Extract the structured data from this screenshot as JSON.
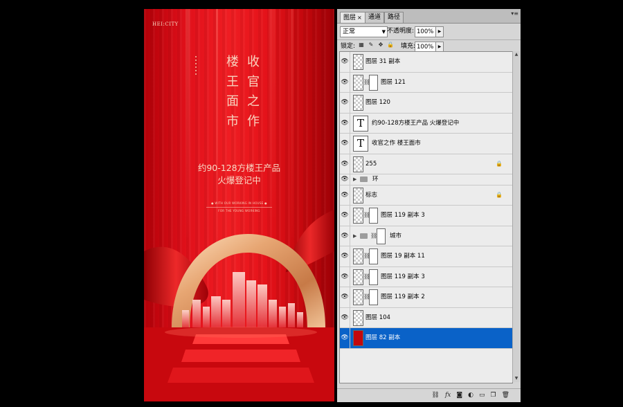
{
  "poster": {
    "brand": "HEI:CITY",
    "vertical_text_left": [
      "楼",
      "王",
      "面",
      "市"
    ],
    "vertical_text_right": [
      "收",
      "官",
      "之",
      "作"
    ],
    "subtitle_line1": "约90-128方楼王产品",
    "subtitle_line2": "火爆登记中",
    "small_text_line1": "● WITH OUR WORKING IN HOUSE  ●",
    "small_text_line2": "FOR THE YOUNG WORKING"
  },
  "panel": {
    "tabs": [
      {
        "label": "图层",
        "active": true
      },
      {
        "label": "通道",
        "active": false
      },
      {
        "label": "路径",
        "active": false
      }
    ],
    "tab_close": "×",
    "blend_mode": "正常",
    "opacity_label": "不透明度:",
    "opacity_value": "100%",
    "lock_label": "锁定:",
    "fill_label": "填充:",
    "fill_value": "100%",
    "layers": [
      {
        "name": "图层 31 副本",
        "type": "pixel"
      },
      {
        "name": "图层 121",
        "type": "masked"
      },
      {
        "name": "图层 120",
        "type": "pixel"
      },
      {
        "name": "约90-128方楼王产品 火爆登记中",
        "type": "text"
      },
      {
        "name": "收官之作 楼王面市",
        "type": "text"
      },
      {
        "name": "255",
        "type": "pixel",
        "locked": true
      },
      {
        "name": "环",
        "type": "group"
      },
      {
        "name": "标志",
        "type": "pixel",
        "locked": true
      },
      {
        "name": "图层 119 副本 3",
        "type": "masked"
      },
      {
        "name": "城市",
        "type": "group-masked"
      },
      {
        "name": "图层 19 副本 11",
        "type": "masked"
      },
      {
        "name": "图层 119 副本 3",
        "type": "masked"
      },
      {
        "name": "图层 119 副本 2",
        "type": "masked"
      },
      {
        "name": "图层 104",
        "type": "pixel"
      },
      {
        "name": "图层 82 副本",
        "type": "pixel-red",
        "selected": true
      }
    ],
    "bottom_icons": [
      "link-icon",
      "fx-icon",
      "mask-icon",
      "adjustment-icon",
      "folder-icon",
      "new-layer-icon",
      "trash-icon"
    ],
    "bottom_fx_label": "fx"
  }
}
